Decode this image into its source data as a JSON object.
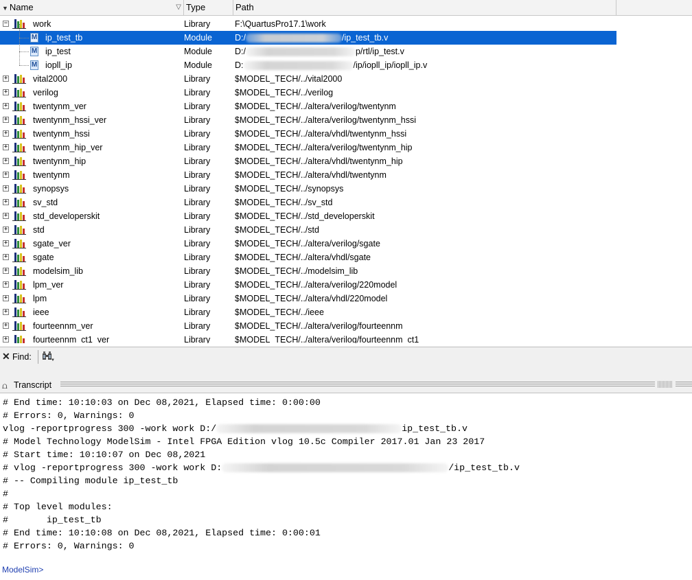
{
  "library": {
    "columns": {
      "name": "Name",
      "type": "Type",
      "path": "Path"
    },
    "rows": [
      {
        "name": "work",
        "type": "Library",
        "path": "F:\\QuartusPro17.1\\work",
        "kind": "library",
        "expanded": true
      },
      {
        "name": "ip_test_tb",
        "type": "Module",
        "path_prefix": "D:/",
        "path_suffix": "/ip_test_tb.v",
        "kind": "module",
        "selected": true
      },
      {
        "name": "ip_test",
        "type": "Module",
        "path_prefix": "D:/",
        "path_suffix": "p/rtl/ip_test.v",
        "kind": "module"
      },
      {
        "name": "iopll_ip",
        "type": "Module",
        "path_prefix": "D:",
        "path_suffix": "/ip/iopll_ip/iopll_ip.v",
        "kind": "module"
      },
      {
        "name": "vital2000",
        "type": "Library",
        "path": "$MODEL_TECH/../vital2000",
        "kind": "library"
      },
      {
        "name": "verilog",
        "type": "Library",
        "path": "$MODEL_TECH/../verilog",
        "kind": "library"
      },
      {
        "name": "twentynm_ver",
        "type": "Library",
        "path": "$MODEL_TECH/../altera/verilog/twentynm",
        "kind": "library"
      },
      {
        "name": "twentynm_hssi_ver",
        "type": "Library",
        "path": "$MODEL_TECH/../altera/verilog/twentynm_hssi",
        "kind": "library"
      },
      {
        "name": "twentynm_hssi",
        "type": "Library",
        "path": "$MODEL_TECH/../altera/vhdl/twentynm_hssi",
        "kind": "library"
      },
      {
        "name": "twentynm_hip_ver",
        "type": "Library",
        "path": "$MODEL_TECH/../altera/verilog/twentynm_hip",
        "kind": "library"
      },
      {
        "name": "twentynm_hip",
        "type": "Library",
        "path": "$MODEL_TECH/../altera/vhdl/twentynm_hip",
        "kind": "library"
      },
      {
        "name": "twentynm",
        "type": "Library",
        "path": "$MODEL_TECH/../altera/vhdl/twentynm",
        "kind": "library"
      },
      {
        "name": "synopsys",
        "type": "Library",
        "path": "$MODEL_TECH/../synopsys",
        "kind": "library"
      },
      {
        "name": "sv_std",
        "type": "Library",
        "path": "$MODEL_TECH/../sv_std",
        "kind": "library"
      },
      {
        "name": "std_developerskit",
        "type": "Library",
        "path": "$MODEL_TECH/../std_developerskit",
        "kind": "library"
      },
      {
        "name": "std",
        "type": "Library",
        "path": "$MODEL_TECH/../std",
        "kind": "library"
      },
      {
        "name": "sgate_ver",
        "type": "Library",
        "path": "$MODEL_TECH/../altera/verilog/sgate",
        "kind": "library"
      },
      {
        "name": "sgate",
        "type": "Library",
        "path": "$MODEL_TECH/../altera/vhdl/sgate",
        "kind": "library"
      },
      {
        "name": "modelsim_lib",
        "type": "Library",
        "path": "$MODEL_TECH/../modelsim_lib",
        "kind": "library"
      },
      {
        "name": "lpm_ver",
        "type": "Library",
        "path": "$MODEL_TECH/../altera/verilog/220model",
        "kind": "library"
      },
      {
        "name": "lpm",
        "type": "Library",
        "path": "$MODEL_TECH/../altera/vhdl/220model",
        "kind": "library"
      },
      {
        "name": "ieee",
        "type": "Library",
        "path": "$MODEL_TECH/../ieee",
        "kind": "library"
      },
      {
        "name": "fourteennm_ver",
        "type": "Library",
        "path": "$MODEL_TECH/../altera/verilog/fourteennm",
        "kind": "library"
      },
      {
        "name": "fourteennm_ct1_ver",
        "type": "Library",
        "path": "$MODEL_TECH/../altera/verilog/fourteennm_ct1",
        "kind": "library"
      }
    ]
  },
  "find": {
    "label": "Find:"
  },
  "transcript": {
    "title": "Transcript",
    "lines": [
      "# End time: 10:10:03 on Dec 08,2021, Elapsed time: 0:00:00",
      "# Errors: 0, Warnings: 0",
      "vlog -reportprogress 300 -work work D:/[redacted]ip_test_tb.v",
      "# Model Technology ModelSim - Intel FPGA Edition vlog 10.5c Compiler 2017.01 Jan 23 2017",
      "# Start time: 10:10:07 on Dec 08,2021",
      "# vlog -reportprogress 300 -work work D:[redacted]/ip_test_tb.v",
      "# -- Compiling module ip_test_tb",
      "#",
      "# Top level modules:",
      "#       ip_test_tb",
      "# End time: 10:10:08 on Dec 08,2021, Elapsed time: 0:00:01",
      "# Errors: 0, Warnings: 0"
    ],
    "prompt": "ModelSim>"
  },
  "icons": {
    "library": "library-bars-icon",
    "module": "module-m-icon",
    "expand": "plus-box-icon",
    "collapse": "minus-box-icon",
    "find_close": "close-icon",
    "find": "binoculars-icon",
    "transcript": "transcript-icon"
  },
  "colors": {
    "selection": "#0a64d2",
    "prompt": "#1f3fb0",
    "header_bg": "#f3f3f3"
  }
}
